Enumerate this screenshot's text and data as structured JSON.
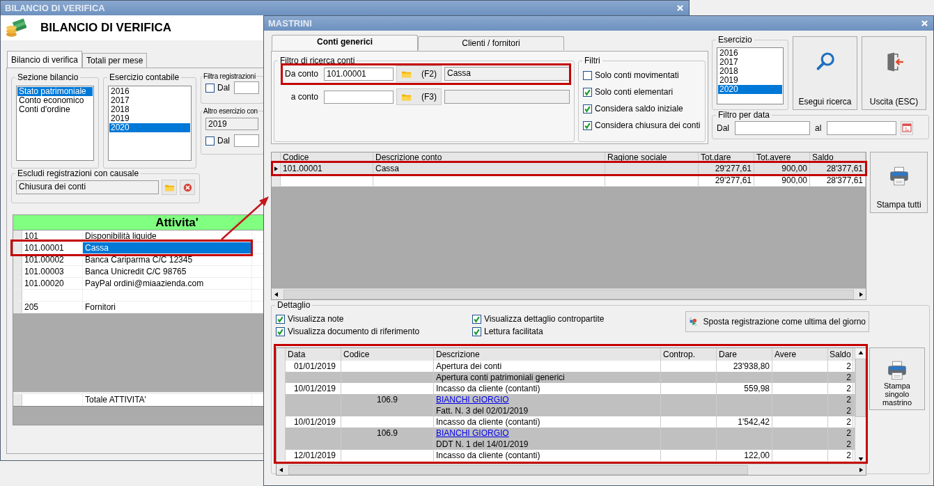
{
  "back_window": {
    "title": "BILANCIO DI VERIFICA",
    "heading": "BILANCIO DI VERIFICA",
    "tabs": [
      {
        "label": "Bilancio di verifica",
        "selected": true
      },
      {
        "label": "Totali per mese",
        "selected": false
      }
    ],
    "sezione_bilancio": {
      "label": "Sezione bilancio",
      "items": [
        {
          "label": "Stato patrimoniale",
          "selected": true
        },
        {
          "label": "Conto economico",
          "selected": false
        },
        {
          "label": "Conti d'ordine",
          "selected": false
        }
      ]
    },
    "esercizio_contabile": {
      "label": "Esercizio contabile",
      "items": [
        {
          "label": "2016",
          "selected": false
        },
        {
          "label": "2017",
          "selected": false
        },
        {
          "label": "2018",
          "selected": false
        },
        {
          "label": "2019",
          "selected": false
        },
        {
          "label": "2020",
          "selected": true
        }
      ]
    },
    "filtra_registrazioni": {
      "label": "Filtra registrazioni",
      "checkbox": {
        "label": "Dal",
        "checked": false
      }
    },
    "altro_esercizio": {
      "label": "Altro esercizio con",
      "value": "2019",
      "checkbox": {
        "label": "Dal",
        "checked": false
      }
    },
    "escludi_causale": {
      "label": "Escludi registrazioni con causale",
      "value": "Chiusura dei conti"
    },
    "section_title": "Attivita'",
    "rows": [
      {
        "kind": "account",
        "code": "101",
        "description": "Disponibilità liquide",
        "selected": false
      },
      {
        "kind": "account",
        "code": "101.00001",
        "description": "Cassa",
        "selected": true
      },
      {
        "kind": "account",
        "code": "101.00002",
        "description": "Banca Cariparma C/C 12345",
        "selected": false
      },
      {
        "kind": "account",
        "code": "101.00003",
        "description": "Banca Unicredit C/C 98765",
        "selected": false
      },
      {
        "kind": "account",
        "code": "101.00020",
        "description": "PayPal ordini@miaazienda.com",
        "selected": false
      },
      {
        "kind": "spacer",
        "selected": false
      },
      {
        "kind": "account",
        "code": "205",
        "description": "Fornitori",
        "selected": false
      }
    ],
    "total_label": "Totale ATTIVITA'"
  },
  "front_window": {
    "title": "MASTRINI",
    "tabs": [
      {
        "label": "Conti generici",
        "selected": true
      },
      {
        "label": "Clienti / fornitori",
        "selected": false
      }
    ],
    "filtro_ricerca": {
      "label": "Filtro di ricerca conti",
      "rows": [
        {
          "label": "Da conto",
          "value": "101.00001",
          "key": "(F2)",
          "description": "Cassa"
        },
        {
          "label": "a conto",
          "key": "(F3)"
        }
      ]
    },
    "filtri": {
      "label": "Filtri",
      "options": [
        {
          "label": "Solo conti movimentati",
          "checked": false
        },
        {
          "label": "Solo conti elementari",
          "checked": true
        },
        {
          "label": "Considera saldo iniziale",
          "checked": true
        },
        {
          "label": "Considera chiusura dei conti",
          "checked": true
        }
      ]
    },
    "esercizio": {
      "label": "Esercizio",
      "items": [
        {
          "label": "2016",
          "selected": false
        },
        {
          "label": "2017",
          "selected": false
        },
        {
          "label": "2018",
          "selected": false
        },
        {
          "label": "2019",
          "selected": false
        },
        {
          "label": "2020",
          "selected": true
        }
      ]
    },
    "buttons": [
      {
        "label": "Esegui ricerca",
        "kind": "search"
      },
      {
        "label": "Uscita (ESC)",
        "kind": "exit"
      }
    ],
    "filtro_data": {
      "label": "Filtro per data",
      "from_label": "Dal",
      "to_label": "al"
    },
    "accounts_table": {
      "columns": [
        "Codice",
        "Descrizione conto",
        "Ragione sociale",
        "Tot.dare",
        "Tot.avere",
        "Saldo"
      ],
      "rows": [
        {
          "code": "101.00001",
          "description": "Cassa",
          "dare": "29'277,61",
          "avere": "900,00",
          "saldo": "28'377,61",
          "selected": true
        },
        {
          "dare": "29'277,61",
          "avere": "900,00",
          "saldo": "28'377,61",
          "selected": false
        }
      ]
    },
    "print_all_button": "Stampa tutti",
    "dettaglio": {
      "label": "Dettaglio",
      "options": [
        {
          "label": "Visualizza note",
          "checked": true
        },
        {
          "label": "Visualizza dettaglio contropartite",
          "checked": true
        },
        {
          "label": "Visualizza documento di riferimento",
          "checked": true
        },
        {
          "label": "Lettura facilitata",
          "checked": true
        }
      ],
      "move_button": "Sposta registrazione come ultima del giorno",
      "columns": [
        "Data",
        "Codice",
        "Descrizione",
        "Controp.",
        "Dare",
        "Avere",
        "Saldo"
      ],
      "rows": [
        {
          "kind": "entry",
          "data": "01/01/2019",
          "description": "Apertura dei conti",
          "dare": "23'938,80",
          "saldo": "2"
        },
        {
          "kind": "note",
          "description": "Apertura conti patrimoniali generici",
          "saldo": "2"
        },
        {
          "kind": "entry",
          "data": "10/01/2019",
          "description": "Incasso da cliente (contanti)",
          "dare": "559,98",
          "saldo": "2"
        },
        {
          "kind": "link",
          "code": "106.9",
          "description": "BIANCHI GIORGIO",
          "saldo": "2"
        },
        {
          "kind": "note",
          "description": "Fatt. N. 3 del 02/01/2019",
          "saldo": "2"
        },
        {
          "kind": "entry",
          "data": "10/01/2019",
          "description": "Incasso da cliente (contanti)",
          "dare": "1'542,42",
          "saldo": "2"
        },
        {
          "kind": "link",
          "code": "106.9",
          "description": "BIANCHI GIORGIO",
          "saldo": "2"
        },
        {
          "kind": "note",
          "description": "DDT N. 1 del 14/01/2019",
          "saldo": "2"
        },
        {
          "kind": "entry",
          "data": "12/01/2019",
          "description": "Incasso da cliente (contanti)",
          "dare": "122,00",
          "saldo": "2"
        }
      ]
    },
    "print_single_button": "Stampa singolo mastrino"
  }
}
